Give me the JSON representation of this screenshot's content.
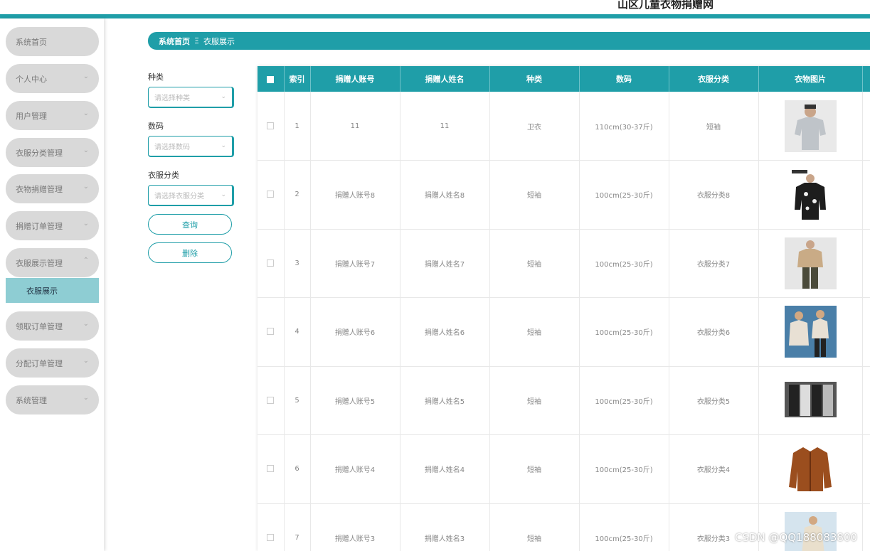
{
  "app": {
    "title": "山区儿童衣物捐赠网"
  },
  "sidebar": {
    "items": [
      {
        "label": "系统首页",
        "chevron": ""
      },
      {
        "label": "个人中心",
        "chevron": "⌄"
      },
      {
        "label": "用户管理",
        "chevron": "⌄"
      },
      {
        "label": "衣服分类管理",
        "chevron": "⌄"
      },
      {
        "label": "衣物捐赠管理",
        "chevron": "⌄"
      },
      {
        "label": "捐赠订单管理",
        "chevron": "⌄"
      },
      {
        "label": "衣服展示管理",
        "chevron": "⌃"
      },
      {
        "label": "领取订单管理",
        "chevron": "⌄"
      },
      {
        "label": "分配订单管理",
        "chevron": "⌄"
      },
      {
        "label": "系统管理",
        "chevron": "⌄"
      }
    ],
    "sub_item": "衣服展示"
  },
  "breadcrumb": {
    "home": "系统首页",
    "separator": "Ξ",
    "current": "衣服展示"
  },
  "filters": {
    "category_label": "种类",
    "category_placeholder": "请选择种类",
    "size_label": "数码",
    "size_placeholder": "请选择数码",
    "clothing_class_label": "衣服分类",
    "clothing_class_placeholder": "请选择衣服分类",
    "query_button": "查询",
    "delete_button": "删除"
  },
  "table": {
    "headers": [
      "索引",
      "捐赠人账号",
      "捐赠人姓名",
      "种类",
      "数码",
      "衣服分类",
      "衣物图片"
    ],
    "rows": [
      {
        "index": "1",
        "account": "11",
        "name": "11",
        "kind": "卫衣",
        "size": "110cm(30-37斤)",
        "category": "短袖",
        "image": "grey-tshirt-man"
      },
      {
        "index": "2",
        "account": "捐赠人账号8",
        "name": "捐赠人姓名8",
        "kind": "短袖",
        "size": "100cm(25-30斤)",
        "category": "衣服分类8",
        "image": "black-print-jacket"
      },
      {
        "index": "3",
        "account": "捐赠人账号7",
        "name": "捐赠人姓名7",
        "kind": "短袖",
        "size": "100cm(25-30斤)",
        "category": "衣服分类7",
        "image": "beige-jacket-man"
      },
      {
        "index": "4",
        "account": "捐赠人账号6",
        "name": "捐赠人姓名6",
        "kind": "短袖",
        "size": "100cm(25-30斤)",
        "category": "衣服分类6",
        "image": "couple-coats"
      },
      {
        "index": "5",
        "account": "捐赠人账号5",
        "name": "捐赠人姓名5",
        "kind": "短袖",
        "size": "100cm(25-30斤)",
        "category": "衣服分类5",
        "image": "black-white-outfit"
      },
      {
        "index": "6",
        "account": "捐赠人账号4",
        "name": "捐赠人姓名4",
        "kind": "短袖",
        "size": "100cm(25-30斤)",
        "category": "衣服分类4",
        "image": "brown-leather-jacket"
      },
      {
        "index": "7",
        "account": "捐赠人账号3",
        "name": "捐赠人姓名3",
        "kind": "短袖",
        "size": "100cm(25-30斤)",
        "category": "衣服分类3",
        "image": "light-coat-woman"
      }
    ]
  },
  "watermark": "CSDN @QQ188083800",
  "colors": {
    "accent": "#1f9ea8",
    "active_sub": "#8ecdd3",
    "nav_bg": "#d9d9d9"
  }
}
